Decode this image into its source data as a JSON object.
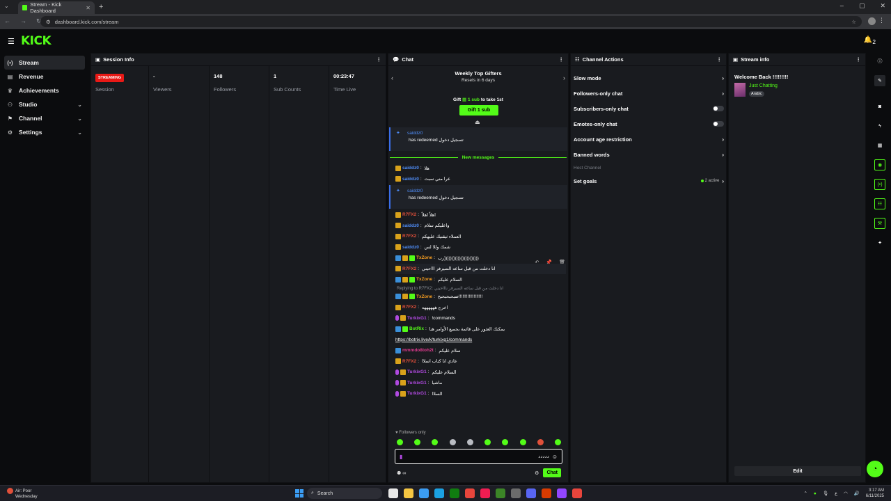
{
  "browser": {
    "tab_title": "Stream - Kick Dashboard",
    "url": "dashboard.kick.com/stream"
  },
  "brand": {
    "logo": "KICK",
    "accent": "#53fc18"
  },
  "header": {
    "notif_count": "2"
  },
  "sidebar": {
    "items": [
      {
        "label": "Stream",
        "icon": "stream-icon"
      },
      {
        "label": "Revenue",
        "icon": "revenue-icon"
      },
      {
        "label": "Achievements",
        "icon": "trophy-icon"
      },
      {
        "label": "Studio",
        "icon": "studio-icon"
      },
      {
        "label": "Channel",
        "icon": "channel-icon"
      },
      {
        "label": "Settings",
        "icon": "gear-icon"
      }
    ]
  },
  "session": {
    "title": "Session Info",
    "badge": "STREAMING",
    "badge_label": "Session",
    "stats": [
      {
        "value": "-",
        "label": "Viewers"
      },
      {
        "value": "148",
        "label": "Followers"
      },
      {
        "value": "1",
        "label": "Sub Counts"
      },
      {
        "value": "00:23:47",
        "label": "Time Live"
      }
    ]
  },
  "chat": {
    "title": "Chat",
    "gifters_title": "Weekly Top Gifters",
    "gifters_sub": "Resets in 6 days",
    "gift_prefix": "Gift",
    "gift_amount": "1 sub",
    "gift_suffix": "to take 1st",
    "gift_button": "Gift 1 sub",
    "redeem1": {
      "user": "saiddz0",
      "text": "has redeemed تسجيل دخول"
    },
    "new_messages": "New messages",
    "redeem2": {
      "user": "saiddz0",
      "text": "has redeemed تسجيل دخول"
    },
    "messages_a": [
      {
        "user": "saiddz0",
        "text": "هلا",
        "color": "#4f8df7"
      },
      {
        "user": "saiddz0",
        "text": "عرا مني سبت",
        "color": "#4f8df7"
      }
    ],
    "messages_b": [
      {
        "user": "R7FX2",
        "text": "اهلاً اهلاً",
        "color": "#e0503a"
      },
      {
        "user": "saiddz0",
        "text": "واعليكم سلام",
        "color": "#4f8df7"
      },
      {
        "user": "R7FX2",
        "text": "العملاء ثيقنيك عليهكم",
        "color": "#e0503a"
      },
      {
        "user": "saiddz0",
        "text": "شمك وللا لس",
        "color": "#4f8df7"
      },
      {
        "user": "TxZone",
        "text": "رب)))))))))))))))))))))))",
        "color": "#f29b21"
      },
      {
        "user": "R7FX2",
        "text": "انا دخلت من قبل ساعه السيرفر اااحيني",
        "color": "#e0503a"
      },
      {
        "user": "TxZone",
        "text": "السلام عليكم",
        "color": "#f29b21"
      }
    ],
    "reply_label": "Replying to R7FX2: انا دخلت من قبل ساعه السيرفر ناااحيني",
    "messages_c": [
      {
        "user": "TxZone",
        "text": "صبحبحبحبح!!!!!!!!!!!!!!!!!!!",
        "color": "#f29b21"
      },
      {
        "user": "R7FX2",
        "text": "اخرج ههههههه",
        "color": "#e0503a"
      },
      {
        "user": "TurkixG1",
        "text": "!commands",
        "color": "#b04ae0"
      },
      {
        "user": "BotRix",
        "text": "يمكنك العثور على قائمة بجميع الأوامر هنا",
        "color": "#53fc18"
      }
    ],
    "botrix_link": "https://botrix.live/k/turkixg1/commands",
    "messages_d": [
      {
        "user": "mmmdo8toh2t",
        "text": "سلام عليكم",
        "color": "#e03a8f"
      },
      {
        "user": "R7FX2",
        "text": "عادي انا كتاب اسلاا",
        "color": "#e0503a"
      },
      {
        "user": "TurkixG1",
        "text": "السلام عليكم",
        "color": "#b04ae0"
      },
      {
        "user": "TurkixG1",
        "text": "ماشيا",
        "color": "#b04ae0"
      },
      {
        "user": "TurkixG1",
        "text": "السلاا",
        "color": "#b04ae0"
      }
    ],
    "followers_only": "Followers only",
    "input_value": "ددددد",
    "send": "Chat"
  },
  "actions": {
    "title": "Channel Actions",
    "items": [
      {
        "label": "Slow mode"
      },
      {
        "label": "Followers-only chat"
      },
      {
        "label": "Subscribers-only chat"
      },
      {
        "label": "Emotes-only chat"
      },
      {
        "label": "Account age restriction"
      },
      {
        "label": "Banned words"
      }
    ],
    "host_channel": "Host Channel",
    "set_goals": "Set goals",
    "goals_active": "2 active"
  },
  "info": {
    "title": "Stream info",
    "welcome": "Welcome Back !!!!!!!!!",
    "category": "Just Chatting",
    "tag": "Arabic",
    "edit": "Edit"
  },
  "taskbar": {
    "weather_title": "Air: Poor",
    "weather_sub": "Wednesday",
    "search": "Search",
    "time": "3:17 AM",
    "date": "6/11/2025",
    "lang": "ع"
  }
}
